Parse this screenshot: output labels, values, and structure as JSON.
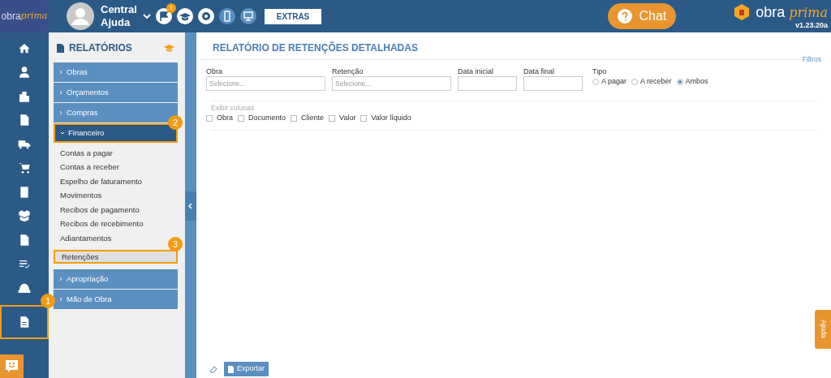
{
  "header": {
    "logo": {
      "first": "obra",
      "second": "prima"
    },
    "user": {
      "name": "Central Ajuda"
    },
    "notification_count": "1",
    "extras_button": "EXTRAS",
    "chat_button": "Chat",
    "brand": {
      "first": "obra",
      "second": "prima",
      "version": "v1.23.20a"
    }
  },
  "rail": {
    "items": [
      {
        "selected": false
      },
      {
        "selected": false
      },
      {
        "selected": false
      },
      {
        "selected": false
      },
      {
        "selected": false
      },
      {
        "selected": false
      },
      {
        "selected": false
      },
      {
        "selected": false
      },
      {
        "selected": false
      },
      {
        "selected": false
      },
      {
        "selected": false
      },
      {
        "selected": true,
        "annotation": "1"
      }
    ]
  },
  "sidebar": {
    "title": "RELATÓRIOS",
    "groups": [
      {
        "label": "Obras",
        "expanded": false
      },
      {
        "label": "Orçamentos",
        "expanded": false
      },
      {
        "label": "Compras",
        "expanded": false
      },
      {
        "label": "Financeiro",
        "expanded": true,
        "annotation": "2",
        "children": [
          {
            "label": "Contas a pagar",
            "selected": false
          },
          {
            "label": "Contas a receber",
            "selected": false
          },
          {
            "label": "Espelho de faturamento",
            "selected": false
          },
          {
            "label": "Movimentos",
            "selected": false
          },
          {
            "label": "Recibos de pagamento",
            "selected": false
          },
          {
            "label": "Recibos de recebimento",
            "selected": false
          },
          {
            "label": "Adiantamentos",
            "selected": false
          },
          {
            "label": "Retenções",
            "selected": true,
            "annotation": "3"
          }
        ]
      },
      {
        "label": "Apropriação",
        "expanded": false
      },
      {
        "label": "Mão de Obra",
        "expanded": false
      }
    ]
  },
  "main": {
    "title": "RELATÓRIO DE RETENÇÕES DETALHADAS",
    "filters_link": "Filtros",
    "fields": [
      {
        "label": "Obra",
        "placeholder": "Selecione...",
        "kind": "select"
      },
      {
        "label": "Retenção",
        "placeholder": "Selecione...",
        "kind": "select"
      },
      {
        "label": "Data inicial",
        "kind": "date"
      },
      {
        "label": "Data final",
        "kind": "date"
      }
    ],
    "tipo": {
      "label": "Tipo",
      "options": [
        {
          "label": "A pagar",
          "selected": false
        },
        {
          "label": "A receber",
          "selected": false
        },
        {
          "label": "Ambos",
          "selected": true
        }
      ]
    },
    "columns": {
      "label": "Exibir colunas",
      "options": [
        {
          "label": "Obra",
          "checked": false
        },
        {
          "label": "Documento",
          "checked": false
        },
        {
          "label": "Cliente",
          "checked": false
        },
        {
          "label": "Valor",
          "checked": false
        },
        {
          "label": "Valor líquido",
          "checked": false
        }
      ]
    },
    "export_button": "Exportar"
  },
  "help_tab": "Ajuda"
}
